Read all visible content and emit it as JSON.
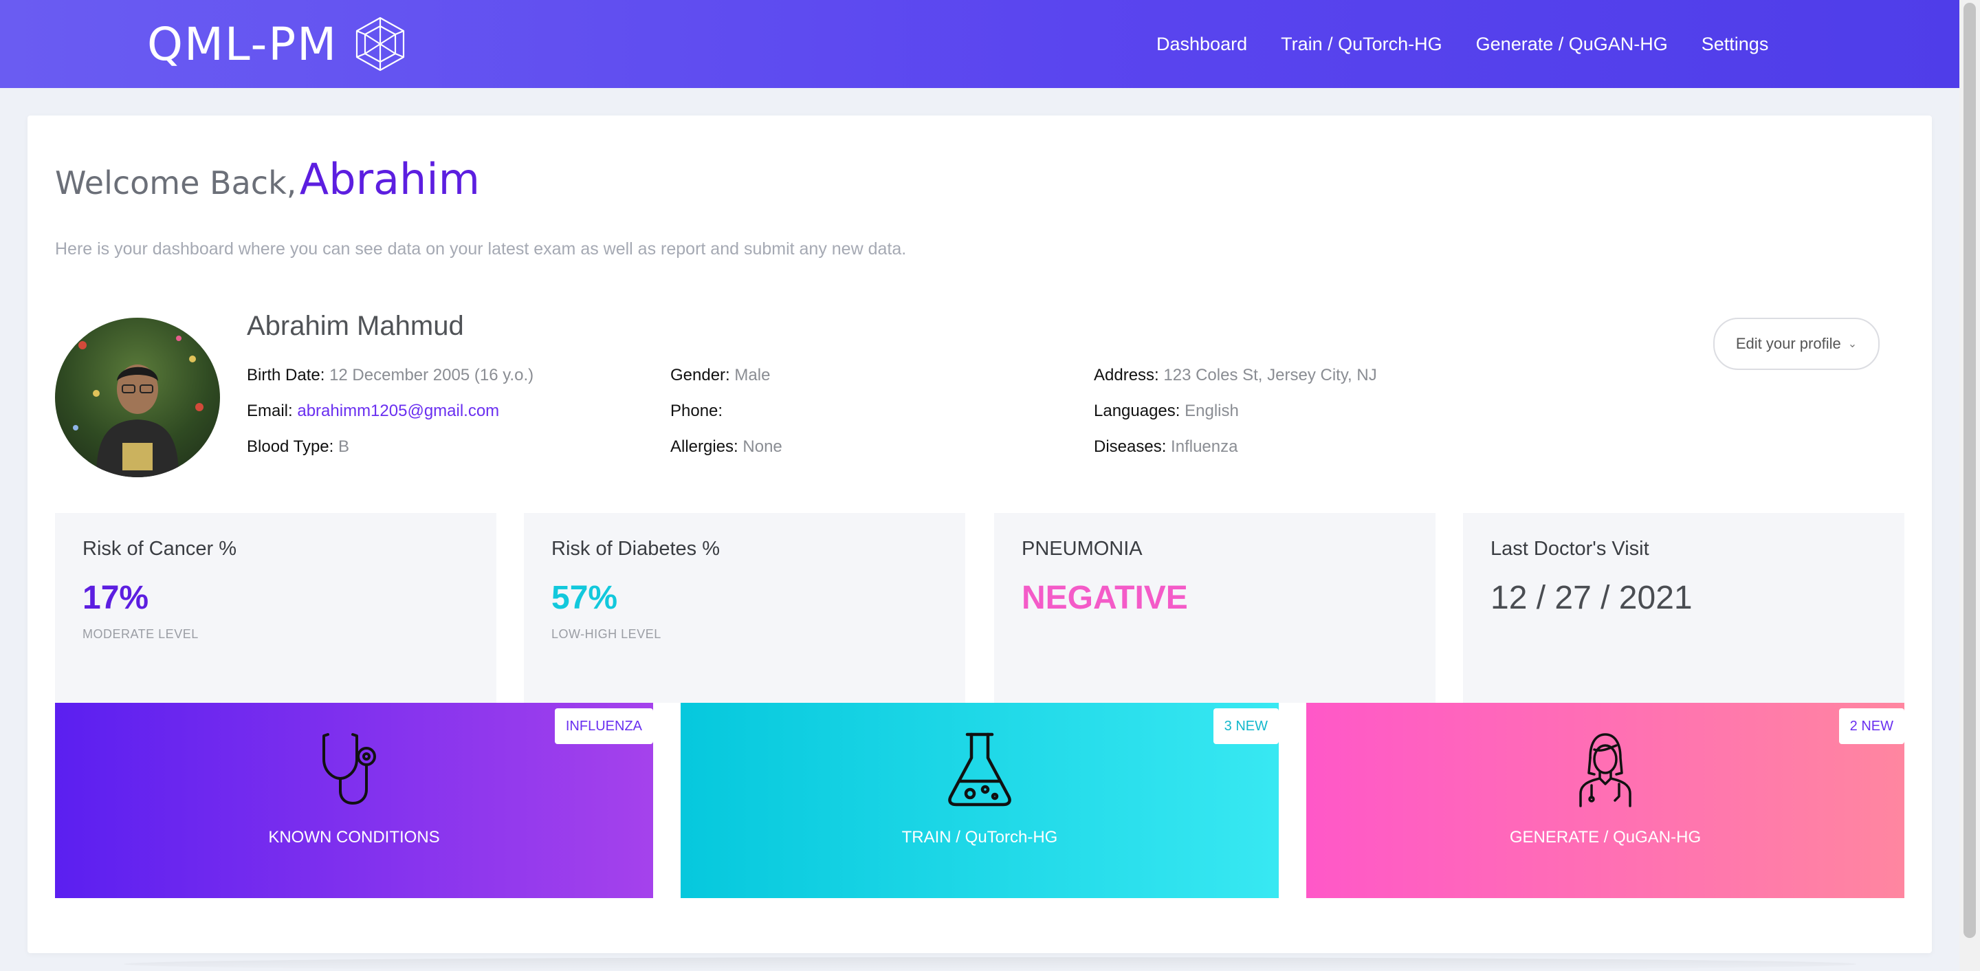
{
  "app": {
    "brand": "QML-PM",
    "nav": [
      "Dashboard",
      "Train / QuTorch-HG",
      "Generate / QuGAN-HG",
      "Settings"
    ]
  },
  "welcome": {
    "prefix": "Welcome Back,",
    "name": "Abrahim",
    "intro": "Here is your dashboard where you can see data on your latest exam as well as report and submit any new data."
  },
  "profile": {
    "name": "Abrahim Mahmud",
    "edit_label": "Edit your profile",
    "fields": {
      "birth_date": {
        "label": "Birth Date:",
        "value": "12 December 2005 (16 y.o.)"
      },
      "email": {
        "label": "Email:",
        "value": "abrahimm1205@gmail.com"
      },
      "blood_type": {
        "label": "Blood Type:",
        "value": "B"
      },
      "gender": {
        "label": "Gender:",
        "value": "Male"
      },
      "phone": {
        "label": "Phone:",
        "value": ""
      },
      "allergies": {
        "label": "Allergies:",
        "value": "None"
      },
      "address": {
        "label": "Address:",
        "value": "123 Coles St, Jersey City, NJ"
      },
      "languages": {
        "label": "Languages:",
        "value": "English"
      },
      "diseases": {
        "label": "Diseases:",
        "value": "Influenza"
      }
    }
  },
  "stats": [
    {
      "title": "Risk of Cancer %",
      "value": "17%",
      "sub": "MODERATE LEVEL",
      "color": "#5c1ee0"
    },
    {
      "title": "Risk of Diabetes %",
      "value": "57%",
      "sub": "LOW-HIGH LEVEL",
      "color": "#12c8dc"
    },
    {
      "title": "PNEUMONIA",
      "value": "NEGATIVE",
      "sub": "",
      "color": "#f45bc8"
    },
    {
      "title": "Last Doctor's Visit",
      "value": "12 / 27 / 2021",
      "sub": "",
      "color": "#4a4d52"
    }
  ],
  "tiles": [
    {
      "label": "KNOWN CONDITIONS",
      "badge": "INFLUENZA",
      "icon": "stethoscope-icon",
      "badge_color": "#6a2ff0"
    },
    {
      "label": "TRAIN / QuTorch-HG",
      "badge": "3 NEW",
      "icon": "flask-icon",
      "badge_color": "#12b8cc"
    },
    {
      "label": "GENERATE / QuGAN-HG",
      "badge": "2 NEW",
      "icon": "doctor-icon",
      "badge_color": "#6a2ff0"
    }
  ],
  "colors": {
    "accent": "#5c1ee0",
    "topbar": "#5a45ef",
    "tile_purple": "#5b1ff0",
    "tile_cyan": "#0bcde0",
    "tile_pink": "#ff5fc4"
  }
}
